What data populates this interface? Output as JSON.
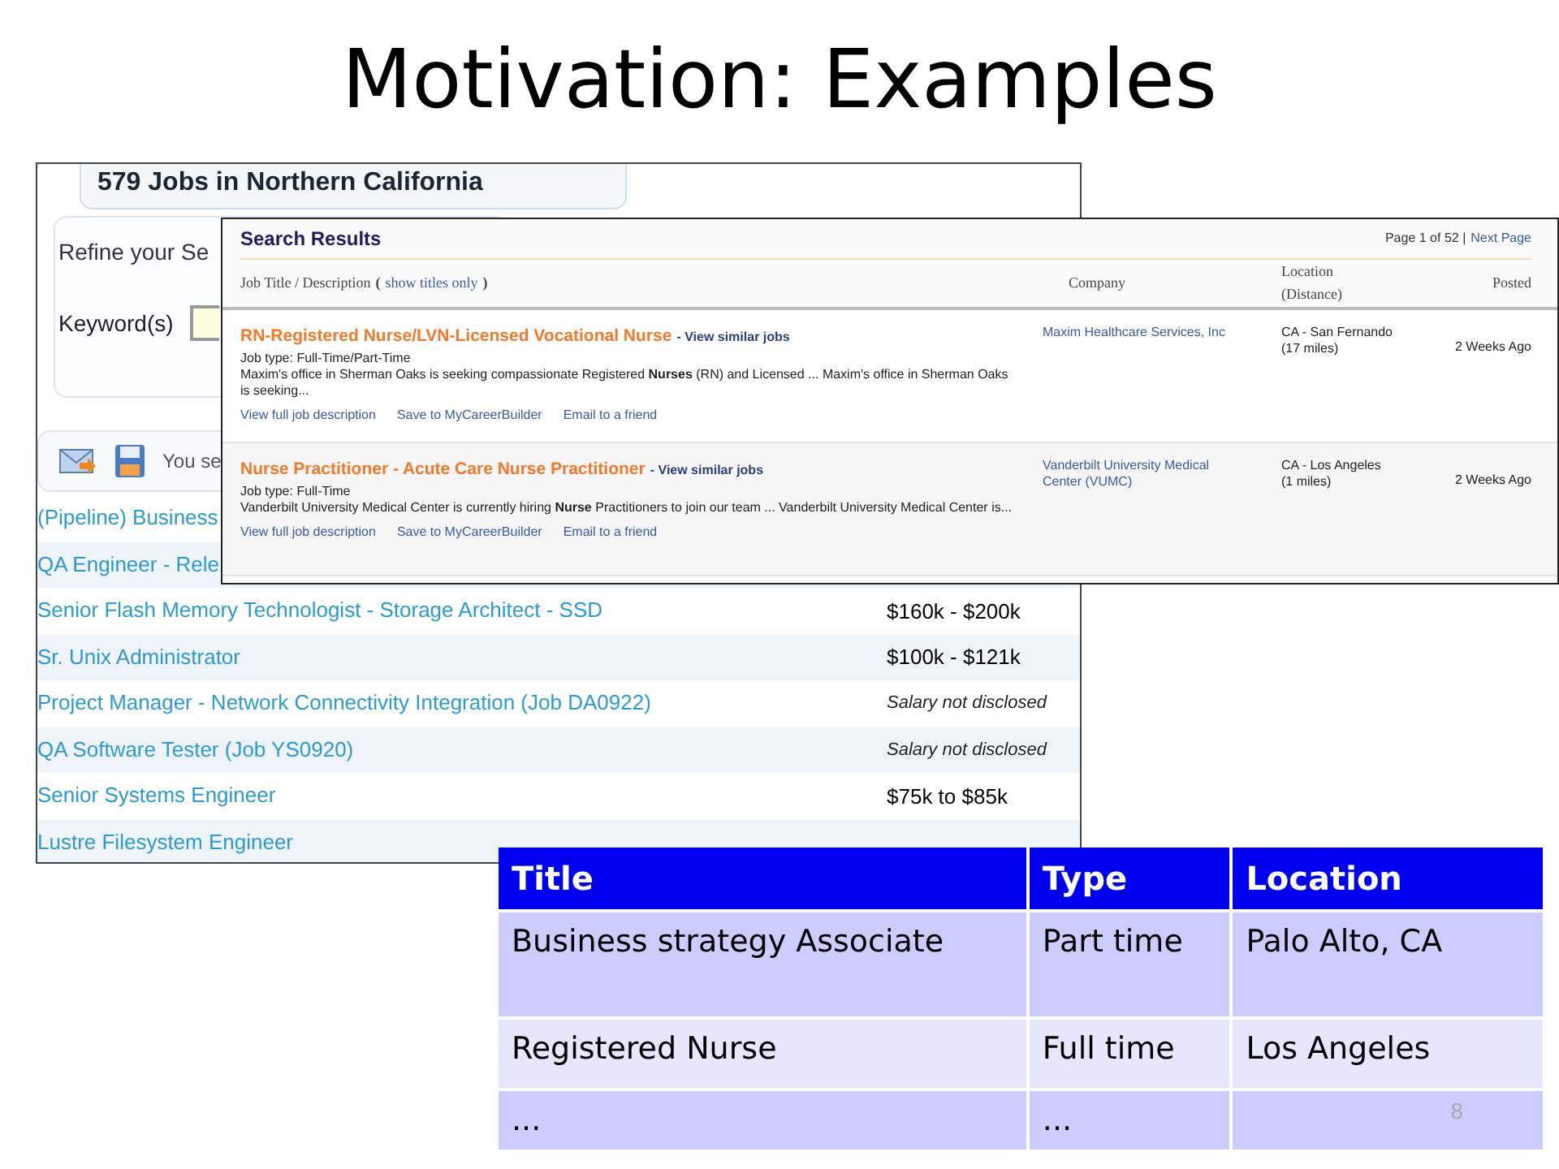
{
  "slide": {
    "title": "Motivation: Examples",
    "page_number": "8"
  },
  "back_page": {
    "heading": "579 Jobs in Northern California",
    "refine_label": "Refine your Se",
    "keyword_label": "Keyword(s)",
    "toolbar_text": "You se",
    "jobs": [
      {
        "title": "(Pipeline) Business"
      },
      {
        "title": "QA Engineer - Rele"
      },
      {
        "title": "Senior Flash Memory Technologist - Storage Architect - SSD",
        "salary": "$160k - $200k",
        "kind": "amount"
      },
      {
        "title": "Sr. Unix Administrator",
        "salary": "$100k - $121k",
        "kind": "amount"
      },
      {
        "title": "Project Manager - Network Connectivity Integration (Job DA0922)",
        "salary": "Salary not disclosed",
        "kind": "undisclosed"
      },
      {
        "title": "QA Software Tester (Job YS0920)",
        "salary": "Salary not disclosed",
        "kind": "undisclosed"
      },
      {
        "title": "Senior Systems Engineer",
        "salary": "$75k to $85k",
        "kind": "amount"
      },
      {
        "title": "Lustre Filesystem Engineer"
      }
    ]
  },
  "front_page": {
    "title": "Search Results",
    "pagination": "Page 1 of 52 |",
    "next_link": "Next Page",
    "columns": {
      "job_title": "Job Title / Description",
      "open_paren": "(",
      "show_titles_link": "show titles only",
      "close_paren": ")",
      "company": "Company",
      "location": "Location (Distance)",
      "posted": "Posted"
    },
    "results": [
      {
        "title": "RN-Registered Nurse/LVN-Licensed Vocational Nurse",
        "similar_link": "- View similar jobs",
        "job_type": "Job type: Full-Time/Part-Time",
        "description": "Maxim's office in Sherman Oaks is seeking compassionate Registered **Nurses** (RN) and Licensed ... Maxim's office in Sherman Oaks is seeking...",
        "links": [
          "View full job description",
          "Save to MyCareerBuilder",
          "Email to a friend"
        ],
        "company": "Maxim Healthcare Services, Inc",
        "location": "CA - San Fernando",
        "distance": "(17 miles)",
        "posted": "2 Weeks Ago"
      },
      {
        "title": "Nurse Practitioner - Acute Care Nurse Practitioner",
        "similar_link": "- View similar jobs",
        "job_type": "Job type: Full-Time",
        "description": "Vanderbilt University Medical Center is currently hiring **Nurse** Practitioners to join our team ... Vanderbilt University Medical Center is...",
        "links": [
          "View full job description",
          "Save to MyCareerBuilder",
          "Email to a friend"
        ],
        "company": "Vanderbilt University Medical Center (VUMC)",
        "location": "CA - Los Angeles",
        "distance": "(1 miles)",
        "posted": "2 Weeks Ago"
      }
    ]
  },
  "table": {
    "columns": [
      "Title",
      "Type",
      "Location"
    ],
    "rows": [
      [
        "Business strategy Associate",
        "Part time",
        "Palo Alto, CA"
      ],
      [
        "Registered Nurse",
        "Full time",
        "Los Angeles"
      ],
      [
        "...",
        "...",
        ""
      ]
    ]
  }
}
